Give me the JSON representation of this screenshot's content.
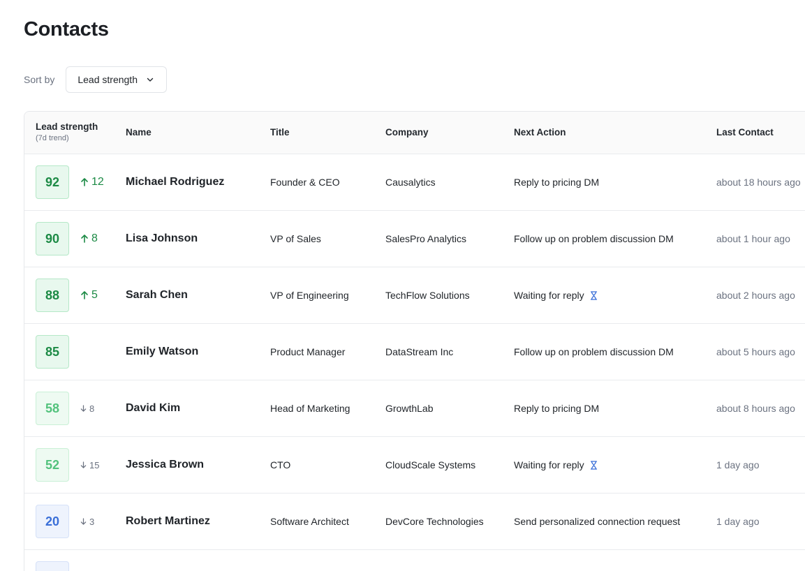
{
  "page": {
    "title": "Contacts"
  },
  "sort": {
    "label": "Sort by",
    "value": "Lead strength"
  },
  "columns": {
    "lead": "Lead strength",
    "lead_sub": "(7d trend)",
    "name": "Name",
    "title": "Title",
    "company": "Company",
    "next_action": "Next Action",
    "last_contact": "Last Contact"
  },
  "rows": [
    {
      "score": "92",
      "level": "high",
      "trend_dir": "up",
      "trend": "12",
      "name": "Michael Rodriguez",
      "title": "Founder & CEO",
      "company": "Causalytics",
      "next_action": "Reply to pricing DM",
      "waiting": false,
      "last_contact": "about 18 hours ago"
    },
    {
      "score": "90",
      "level": "high",
      "trend_dir": "up",
      "trend": "8",
      "name": "Lisa Johnson",
      "title": "VP of Sales",
      "company": "SalesPro Analytics",
      "next_action": "Follow up on problem discussion DM",
      "waiting": false,
      "last_contact": "about 1 hour ago"
    },
    {
      "score": "88",
      "level": "high",
      "trend_dir": "up",
      "trend": "5",
      "name": "Sarah Chen",
      "title": "VP of Engineering",
      "company": "TechFlow Solutions",
      "next_action": "Waiting for reply",
      "waiting": true,
      "last_contact": "about 2 hours ago"
    },
    {
      "score": "85",
      "level": "high",
      "trend_dir": "none",
      "trend": "",
      "name": "Emily Watson",
      "title": "Product Manager",
      "company": "DataStream Inc",
      "next_action": "Follow up on problem discussion DM",
      "waiting": false,
      "last_contact": "about 5 hours ago"
    },
    {
      "score": "58",
      "level": "mid",
      "trend_dir": "down",
      "trend": "8",
      "name": "David Kim",
      "title": "Head of Marketing",
      "company": "GrowthLab",
      "next_action": "Reply to pricing DM",
      "waiting": false,
      "last_contact": "about 8 hours ago"
    },
    {
      "score": "52",
      "level": "mid",
      "trend_dir": "down",
      "trend": "15",
      "name": "Jessica Brown",
      "title": "CTO",
      "company": "CloudScale Systems",
      "next_action": "Waiting for reply",
      "waiting": true,
      "last_contact": "1 day ago"
    },
    {
      "score": "20",
      "level": "low",
      "trend_dir": "down",
      "trend": "3",
      "name": "Robert Martinez",
      "title": "Software Architect",
      "company": "DevCore Technologies",
      "next_action": "Send personalized connection request",
      "waiting": false,
      "last_contact": "1 day ago"
    }
  ],
  "icons": {
    "sort_chevron": "chevron-down-icon",
    "trend_up": "arrow-up-icon",
    "trend_down": "arrow-down-icon",
    "waiting": "hourglass-icon"
  },
  "colors": {
    "high": "#1c8a45",
    "mid": "#52c27c",
    "low": "#3a6fd8",
    "hourglass": "#3a6fd8"
  }
}
